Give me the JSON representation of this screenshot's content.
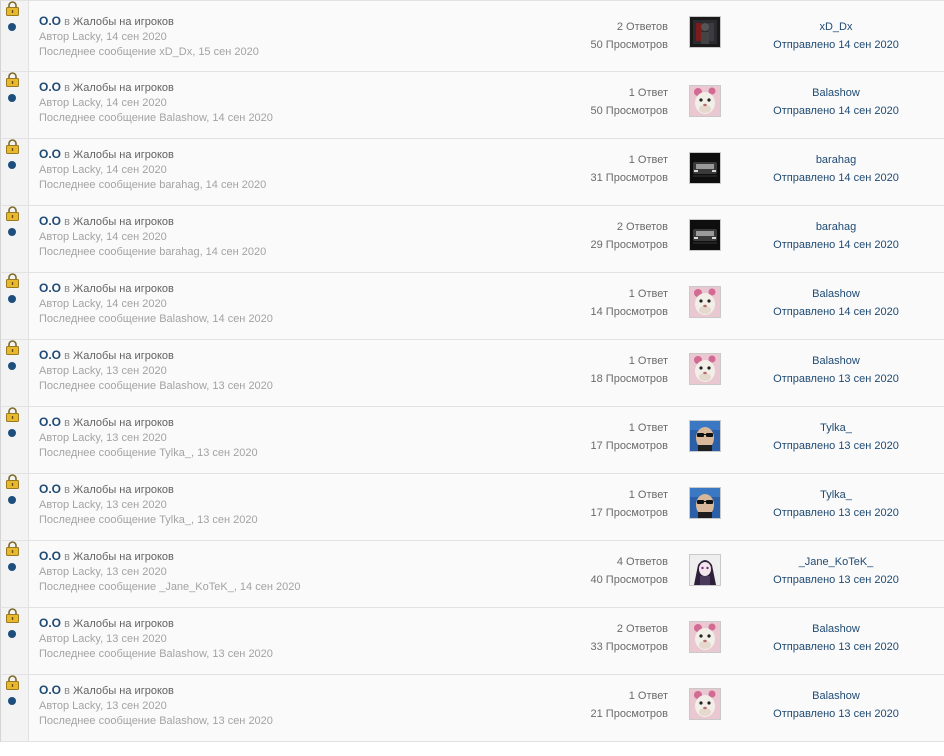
{
  "threads": [
    {
      "title": "O.O",
      "in": "в",
      "forum": "Жалобы на игроков",
      "author": "Автор Lacky, 14 сен 2020",
      "last_message": "Последнее сообщение xD_Dx, 15 сен 2020",
      "replies": "2 Ответов",
      "views": "50 Просмотров",
      "last_user": "xD_Dx",
      "sent": "Отправлено 14 сен 2020",
      "avatar": "avatar-dark-figure"
    },
    {
      "title": "O.O",
      "in": "в",
      "forum": "Жалобы на игроков",
      "author": "Автор Lacky, 14 сен 2020",
      "last_message": "Последнее сообщение Balashow, 14 сен 2020",
      "replies": "1 Ответ",
      "views": "50 Просмотров",
      "last_user": "Balashow",
      "sent": "Отправлено 14 сен 2020",
      "avatar": "avatar-cat"
    },
    {
      "title": "O.O",
      "in": "в",
      "forum": "Жалобы на игроков",
      "author": "Автор Lacky, 14 сен 2020",
      "last_message": "Последнее сообщение barahag, 14 сен 2020",
      "replies": "1 Ответ",
      "views": "31 Просмотров",
      "last_user": "barahag",
      "sent": "Отправлено 14 сен 2020",
      "avatar": "avatar-car"
    },
    {
      "title": "O.O",
      "in": "в",
      "forum": "Жалобы на игроков",
      "author": "Автор Lacky, 14 сен 2020",
      "last_message": "Последнее сообщение barahag, 14 сен 2020",
      "replies": "2 Ответов",
      "views": "29 Просмотров",
      "last_user": "barahag",
      "sent": "Отправлено 14 сен 2020",
      "avatar": "avatar-car"
    },
    {
      "title": "O.O",
      "in": "в",
      "forum": "Жалобы на игроков",
      "author": "Автор Lacky, 14 сен 2020",
      "last_message": "Последнее сообщение Balashow, 14 сен 2020",
      "replies": "1 Ответ",
      "views": "14 Просмотров",
      "last_user": "Balashow",
      "sent": "Отправлено 14 сен 2020",
      "avatar": "avatar-cat"
    },
    {
      "title": "O.O",
      "in": "в",
      "forum": "Жалобы на игроков",
      "author": "Автор Lacky, 13 сен 2020",
      "last_message": "Последнее сообщение Balashow, 13 сен 2020",
      "replies": "1 Ответ",
      "views": "18 Просмотров",
      "last_user": "Balashow",
      "sent": "Отправлено 13 сен 2020",
      "avatar": "avatar-cat"
    },
    {
      "title": "O.O",
      "in": "в",
      "forum": "Жалобы на игроков",
      "author": "Автор Lacky, 13 сен 2020",
      "last_message": "Последнее сообщение Tylka_, 13 сен 2020",
      "replies": "1 Ответ",
      "views": "17 Просмотров",
      "last_user": "Tylka_",
      "sent": "Отправлено 13 сен 2020",
      "avatar": "avatar-sunglasses"
    },
    {
      "title": "O.O",
      "in": "в",
      "forum": "Жалобы на игроков",
      "author": "Автор Lacky, 13 сен 2020",
      "last_message": "Последнее сообщение Tylka_, 13 сен 2020",
      "replies": "1 Ответ",
      "views": "17 Просмотров",
      "last_user": "Tylka_",
      "sent": "Отправлено 13 сен 2020",
      "avatar": "avatar-sunglasses"
    },
    {
      "title": "O.O",
      "in": "в",
      "forum": "Жалобы на игроков",
      "author": "Автор Lacky, 13 сен 2020",
      "last_message": "Последнее сообщение _Jane_KoTeK_, 14 сен 2020",
      "replies": "4 Ответов",
      "views": "40 Просмотров",
      "last_user": "_Jane_KoTeK_",
      "sent": "Отправлено 13 сен 2020",
      "avatar": "avatar-anime"
    },
    {
      "title": "O.O",
      "in": "в",
      "forum": "Жалобы на игроков",
      "author": "Автор Lacky, 13 сен 2020",
      "last_message": "Последнее сообщение Balashow, 13 сен 2020",
      "replies": "2 Ответов",
      "views": "33 Просмотров",
      "last_user": "Balashow",
      "sent": "Отправлено 13 сен 2020",
      "avatar": "avatar-cat"
    },
    {
      "title": "O.O",
      "in": "в",
      "forum": "Жалобы на игроков",
      "author": "Автор Lacky, 13 сен 2020",
      "last_message": "Последнее сообщение Balashow, 13 сен 2020",
      "replies": "1 Ответ",
      "views": "21 Просмотров",
      "last_user": "Balashow",
      "sent": "Отправлено 13 сен 2020",
      "avatar": "avatar-cat"
    }
  ]
}
